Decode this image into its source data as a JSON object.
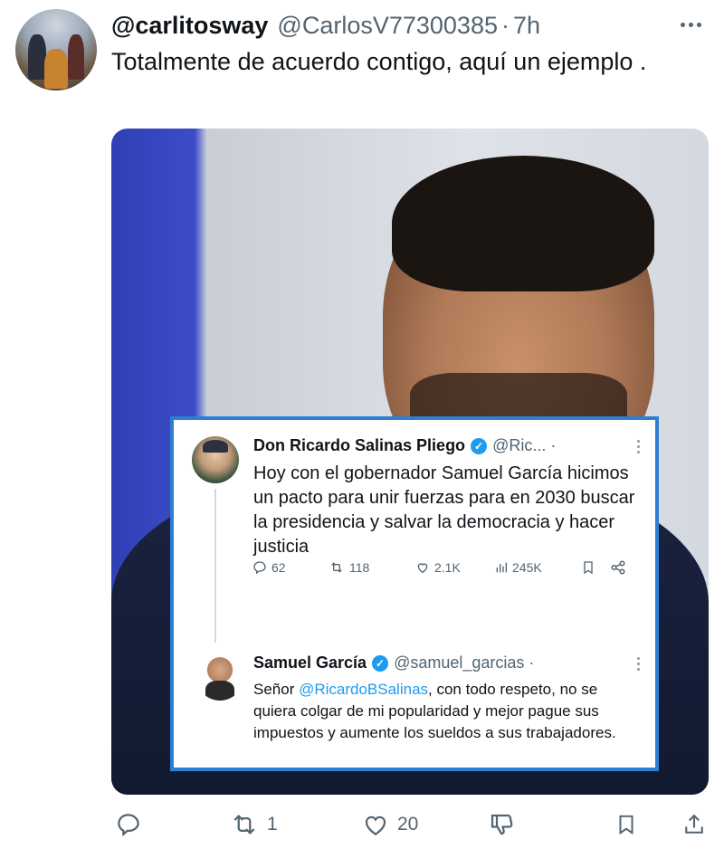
{
  "tweet": {
    "display_name": "@carlitosway",
    "handle": "@CarlosV77300385",
    "separator": "·",
    "time": "7h",
    "text": "Totalmente de acuerdo contigo, aquí un ejemplo ."
  },
  "embedded": {
    "post1": {
      "name": "Don Ricardo Salinas Pliego",
      "handle": "@Ric... ·",
      "text": "Hoy con el gobernador Samuel García hicimos un pacto para unir fuerzas para en 2030 buscar la presidencia y salvar la democracia y hacer justicia",
      "replies": "62",
      "retweets": "118",
      "likes": "2.1K",
      "views": "245K"
    },
    "post2": {
      "name": "Samuel García",
      "handle": "@samuel_garcias ·",
      "text_prefix": "Señor ",
      "mention": "@RicardoBSalinas",
      "text_suffix": ", con todo respeto, no se quiera colgar de mi popularidad y mejor pague sus impuestos y aumente los sueldos a sus trabajadores."
    }
  },
  "actions": {
    "replies": "",
    "retweets": "1",
    "likes": "20"
  },
  "colors": {
    "link": "#1d9bf0",
    "muted": "#536471",
    "embed_border": "#2d7fd3"
  }
}
